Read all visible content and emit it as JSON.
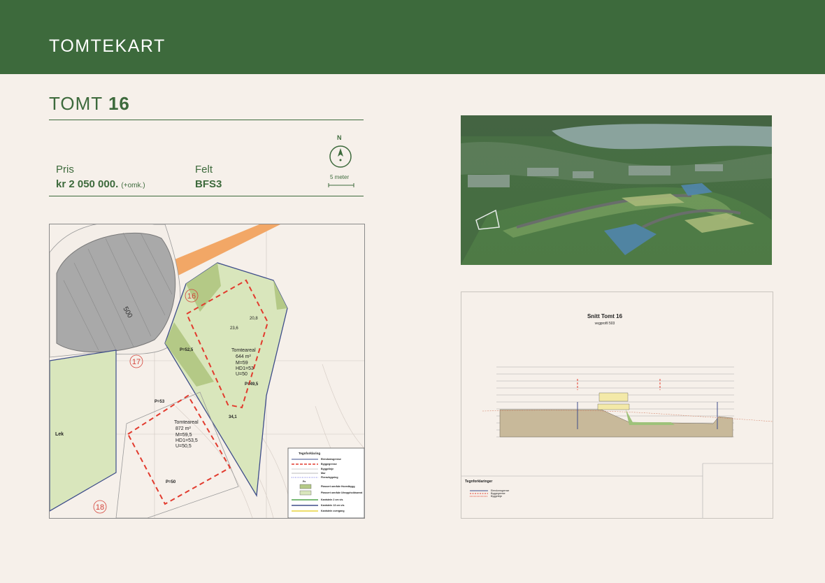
{
  "header": {
    "title": "TOMTEKART"
  },
  "plot": {
    "label": "TOMT",
    "number": "16"
  },
  "info": {
    "price_label": "Pris",
    "price_value": "kr 2 050 000.",
    "price_note": "(+omk.)",
    "field_label": "Felt",
    "field_value": "BFS3"
  },
  "compass": {
    "north": "N",
    "scale_label": "5 meter"
  },
  "map": {
    "roundabout_label": "500",
    "plots": [
      {
        "number": "16",
        "name": "Tomteareal",
        "area": "644 m²",
        "m": "M=59",
        "hd": "HD1=53",
        "u": "U=50"
      },
      {
        "number": "17",
        "name": "Tomteareal",
        "area": "872 m²",
        "m": "M=59,5",
        "hd": "HD1=53,5",
        "u": "U=50,5"
      },
      {
        "number": "18"
      }
    ],
    "p_labels": [
      "P=52,5",
      "P=49,5",
      "P=53",
      "P=50"
    ],
    "dims": [
      "23,6",
      "20,8",
      "34,1"
    ],
    "lek_label": "Lek",
    "legend": {
      "title": "Tegnforklaring",
      "items": [
        "Eiendomsgrense",
        "Byggegrense",
        "Byggelinje",
        "Mur",
        "Fleravbygning",
        "Pe",
        "Plassert område Hovedbygg",
        "Plassert område Uteoppholdsareal",
        "Kantstein 2 cm vis",
        "Kantstein 13 cm vis",
        "Kantstein overgang"
      ]
    },
    "colors": {
      "roundabout": "#a9a9a9",
      "road": "#f2a766",
      "green_light": "#d9e6bc",
      "green_dark": "#b4c986",
      "boundary": "#3e4d8a",
      "buildline": "#e23b2e"
    }
  },
  "section": {
    "title": "Snitt Tomt 16",
    "subtitle": "vegprofil 503",
    "legend_title": "Tegnforklaringer",
    "legend_items": [
      "Eiendomsgrense",
      "Byggegrense",
      "Byggelinje"
    ]
  }
}
